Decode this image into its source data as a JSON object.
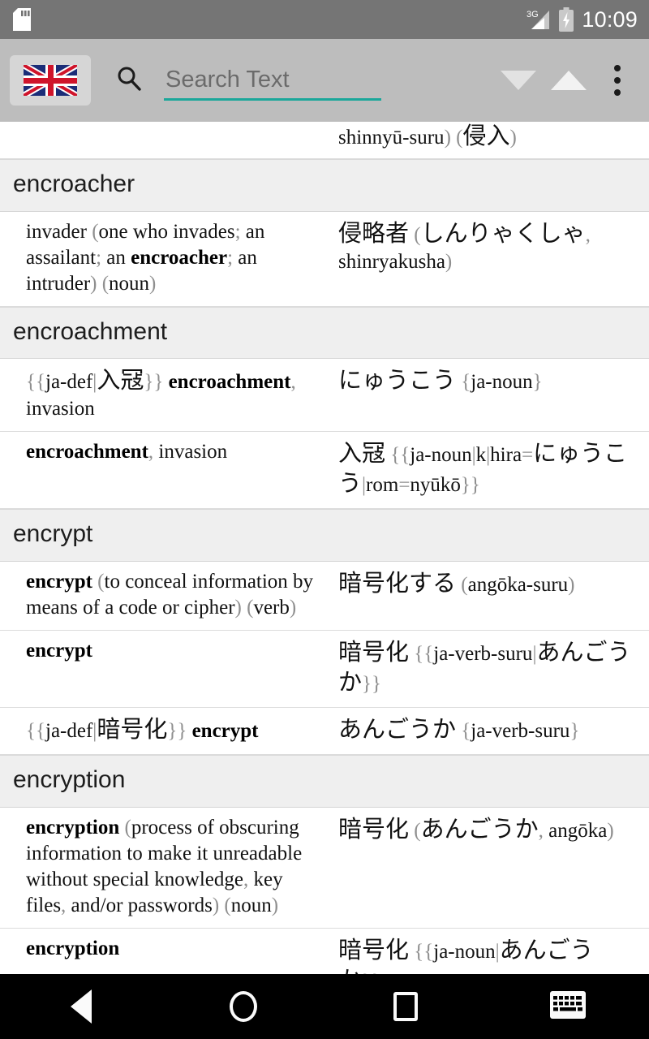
{
  "status_bar": {
    "sd_icon": "sd-card-icon",
    "network_label": "3G",
    "signal_icon": "signal-bars-icon",
    "battery_icon": "battery-charging-icon",
    "time": "10:09"
  },
  "action_bar": {
    "flag_button": "UK",
    "flag_icon": "union-jack-flag-icon",
    "search_icon": "search-icon",
    "search_placeholder": "Search Text",
    "search_value": "",
    "scroll_down_icon": "triangle-down-icon",
    "scroll_up_icon": "triangle-up-icon",
    "overflow_icon": "more-vertical-icon",
    "accent_color": "#1aa79a",
    "bar_color": "#bdbdbd"
  },
  "list": {
    "partial_top_row": {
      "left": "",
      "right_plain_tail": "shinnyū-suru) (侵入)"
    },
    "sections": [
      {
        "headword": "encroacher",
        "entries": [
          {
            "left_plain": "invader (one who invades; an assailant; an encroacher; an intruder) (noun)",
            "right_plain": "侵略者 (しんりゃくしゃ, shinryakusha)"
          }
        ]
      },
      {
        "headword": "encroachment",
        "entries": [
          {
            "left_plain": "{{ja-def|入冦}} encroachment, invasion",
            "right_plain": "にゅうこう {ja-noun}"
          },
          {
            "left_plain": "encroachment, invasion",
            "right_plain": "入冦 {{ja-noun|k|hira=にゅうこう|rom=nyūkō}}"
          }
        ]
      },
      {
        "headword": "encrypt",
        "entries": [
          {
            "left_plain": "encrypt (to conceal information by means of a code or cipher) (verb)",
            "right_plain": "暗号化する (angōka-suru)"
          },
          {
            "left_plain": "encrypt",
            "right_plain": "暗号化 {{ja-verb-suru|あんごうか}}"
          },
          {
            "left_plain": "{{ja-def|暗号化}} encrypt",
            "right_plain": "あんごうか {ja-verb-suru}"
          }
        ]
      },
      {
        "headword": "encryption",
        "entries": [
          {
            "left_plain": "encryption (process of obscuring information to make it unreadable without special knowledge, key files, and/or passwords) (noun)",
            "right_plain": "暗号化 (あんごうか, angōka)"
          },
          {
            "left_plain": "encryption",
            "right_plain": "暗号化 {{ja-noun|あんごうか}}"
          }
        ]
      }
    ]
  },
  "nav_bar": {
    "back_icon": "back-triangle-icon",
    "home_icon": "home-circle-icon",
    "recents_icon": "recents-square-icon",
    "keyboard_icon": "keyboard-icon"
  }
}
